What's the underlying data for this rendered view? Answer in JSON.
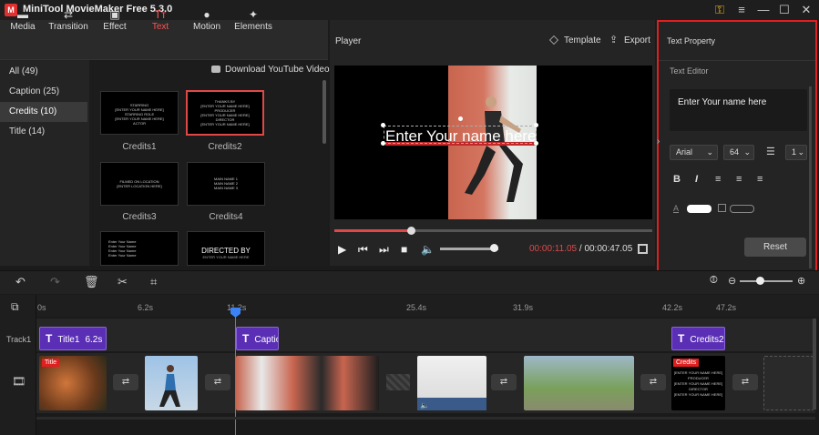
{
  "app": {
    "title": "MiniTool MovieMaker Free 5.3.0",
    "logo": "M"
  },
  "window": {
    "key_icon": "key-icon",
    "menu_icon": "≡",
    "min": "—",
    "max": "☐",
    "close": "✕"
  },
  "toolbar": {
    "items": [
      {
        "label": "Media",
        "icon": "folder-icon"
      },
      {
        "label": "Transition",
        "icon": "transition-icon"
      },
      {
        "label": "Effect",
        "icon": "effect-icon"
      },
      {
        "label": "Text",
        "icon": "text-icon",
        "active": true
      },
      {
        "label": "Motion",
        "icon": "motion-icon"
      },
      {
        "label": "Elements",
        "icon": "elements-icon"
      }
    ]
  },
  "categories": [
    {
      "label": "All (49)"
    },
    {
      "label": "Caption (25)"
    },
    {
      "label": "Credits (10)",
      "selected": true
    },
    {
      "label": "Title (14)"
    }
  ],
  "library": {
    "download_label": "Download YouTube Videos",
    "items": [
      {
        "label": "Credits1",
        "lines": [
          "STARRING",
          "[ENTER YOUR NAME HERE]",
          "STARRING ROLE",
          "[ENTER YOUR NAME HERE]",
          "ACTOR"
        ]
      },
      {
        "label": "Credits2",
        "lines": [
          "THANKS BY",
          "[ENTER YOUR NAME HERE]",
          "PRODUCER",
          "[ENTER YOUR NAME HERE]",
          "DIRECTOR",
          "[ENTER YOUR NAME HERE]"
        ],
        "selected": true
      },
      {
        "label": "Credits3",
        "lines": [
          "FILMED ON LOCATION",
          "[ENTER LOCATION HERE]"
        ]
      },
      {
        "label": "Credits4",
        "lines": [
          "MAIN NAME 1",
          "MAIN NAME 2",
          "MAIN NAME 3"
        ]
      },
      {
        "label": "",
        "lines": [
          "Enter Your Name",
          "Enter Your Name",
          "Enter Your Name",
          "Enter Your Name"
        ]
      },
      {
        "label": "",
        "lines": [
          "DIRECTED BY",
          "ENTER YOUR NAME HERE"
        ]
      }
    ]
  },
  "player": {
    "title": "Player",
    "template_label": "Template",
    "export_label": "Export",
    "overlay_text": "Enter Your name here",
    "progress": 0.24,
    "volume": 0.92,
    "time_current": "00:00:11.05",
    "time_sep": " / ",
    "time_total": "00:00:47.05"
  },
  "property": {
    "title": "Text Property",
    "editor_label": "Text Editor",
    "editor_text": "Enter Your name here",
    "font": "Arial",
    "size": "64",
    "line_spacing": "1",
    "bold": "B",
    "italic": "I",
    "reset_label": "Reset",
    "text_color": "#ffffff"
  },
  "timeline": {
    "ruler": [
      "0s",
      "6.2s",
      "11.2s",
      "25.4s",
      "31.9s",
      "42.2s",
      "47.2s"
    ],
    "track1_label": "Track1",
    "text_clips": [
      {
        "label": "Title1",
        "duration": "6.2s"
      },
      {
        "label": "Caption"
      },
      {
        "label": "Credits2"
      }
    ],
    "video_tags": [
      "Title",
      "Credits"
    ],
    "credit_clip_lines": [
      "[ENTER YOUR NAME HERE]",
      "PRODUCER",
      "[ENTER YOUR NAME HERE]",
      "DIRECTOR",
      "[ENTER YOUR NAME HERE]"
    ]
  },
  "colors": {
    "accent": "#e04848",
    "clip_purple": "#5b2fb5",
    "playhead": "#3b82f6"
  }
}
